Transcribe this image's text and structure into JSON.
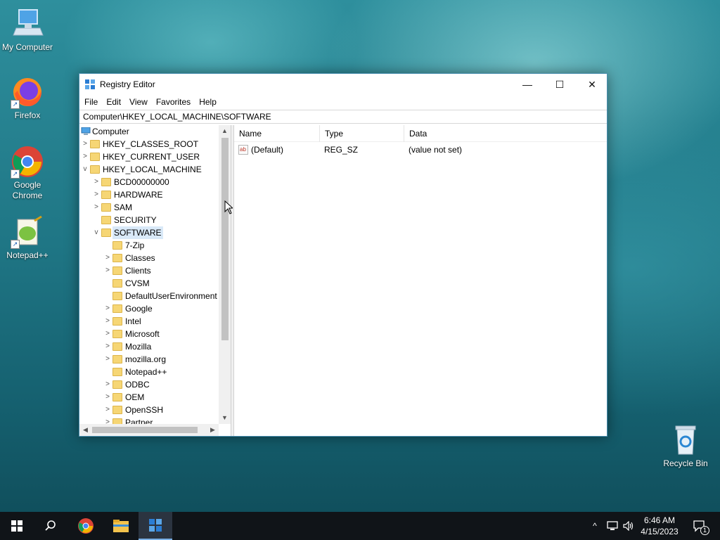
{
  "desktop": {
    "icons": [
      {
        "label": "My Computer"
      },
      {
        "label": "Firefox"
      },
      {
        "label": "Google Chrome"
      },
      {
        "label": "Notepad++"
      },
      {
        "label": "Recycle Bin"
      }
    ]
  },
  "window": {
    "title": "Registry Editor",
    "controls": {
      "minimize": "—",
      "maximize": "☐",
      "close": "✕"
    },
    "menu": [
      "File",
      "Edit",
      "View",
      "Favorites",
      "Help"
    ],
    "address": "Computer\\HKEY_LOCAL_MACHINE\\SOFTWARE"
  },
  "tree": {
    "root": "Computer",
    "items": [
      {
        "label": "HKEY_CLASSES_ROOT",
        "expander": ">"
      },
      {
        "label": "HKEY_CURRENT_USER",
        "expander": ">"
      },
      {
        "label": "HKEY_LOCAL_MACHINE",
        "expander": "v"
      },
      {
        "label": "BCD00000000",
        "expander": ">"
      },
      {
        "label": "HARDWARE",
        "expander": ">"
      },
      {
        "label": "SAM",
        "expander": ">"
      },
      {
        "label": "SECURITY",
        "expander": ""
      },
      {
        "label": "SOFTWARE",
        "expander": "v",
        "selected": true
      },
      {
        "label": "7-Zip",
        "expander": ""
      },
      {
        "label": "Classes",
        "expander": ">"
      },
      {
        "label": "Clients",
        "expander": ">"
      },
      {
        "label": "CVSM",
        "expander": ""
      },
      {
        "label": "DefaultUserEnvironment",
        "expander": ""
      },
      {
        "label": "Google",
        "expander": ">"
      },
      {
        "label": "Intel",
        "expander": ">"
      },
      {
        "label": "Microsoft",
        "expander": ">"
      },
      {
        "label": "Mozilla",
        "expander": ">"
      },
      {
        "label": "mozilla.org",
        "expander": ">"
      },
      {
        "label": "Notepad++",
        "expander": ""
      },
      {
        "label": "ODBC",
        "expander": ">"
      },
      {
        "label": "OEM",
        "expander": ">"
      },
      {
        "label": "OpenSSH",
        "expander": ">"
      },
      {
        "label": "Partner",
        "expander": ">"
      }
    ]
  },
  "list": {
    "columns": [
      "Name",
      "Type",
      "Data"
    ],
    "rows": [
      {
        "name": "(Default)",
        "type": "REG_SZ",
        "data": "(value not set)",
        "icon": "ab"
      }
    ]
  },
  "taskbar": {
    "tray_chevron": "^",
    "time": "6:46 AM",
    "date": "4/15/2023",
    "notification_count": "1"
  },
  "colors": {
    "accent": "#0078d7",
    "selection": "#d9e9f8",
    "taskbar": "#101418"
  }
}
